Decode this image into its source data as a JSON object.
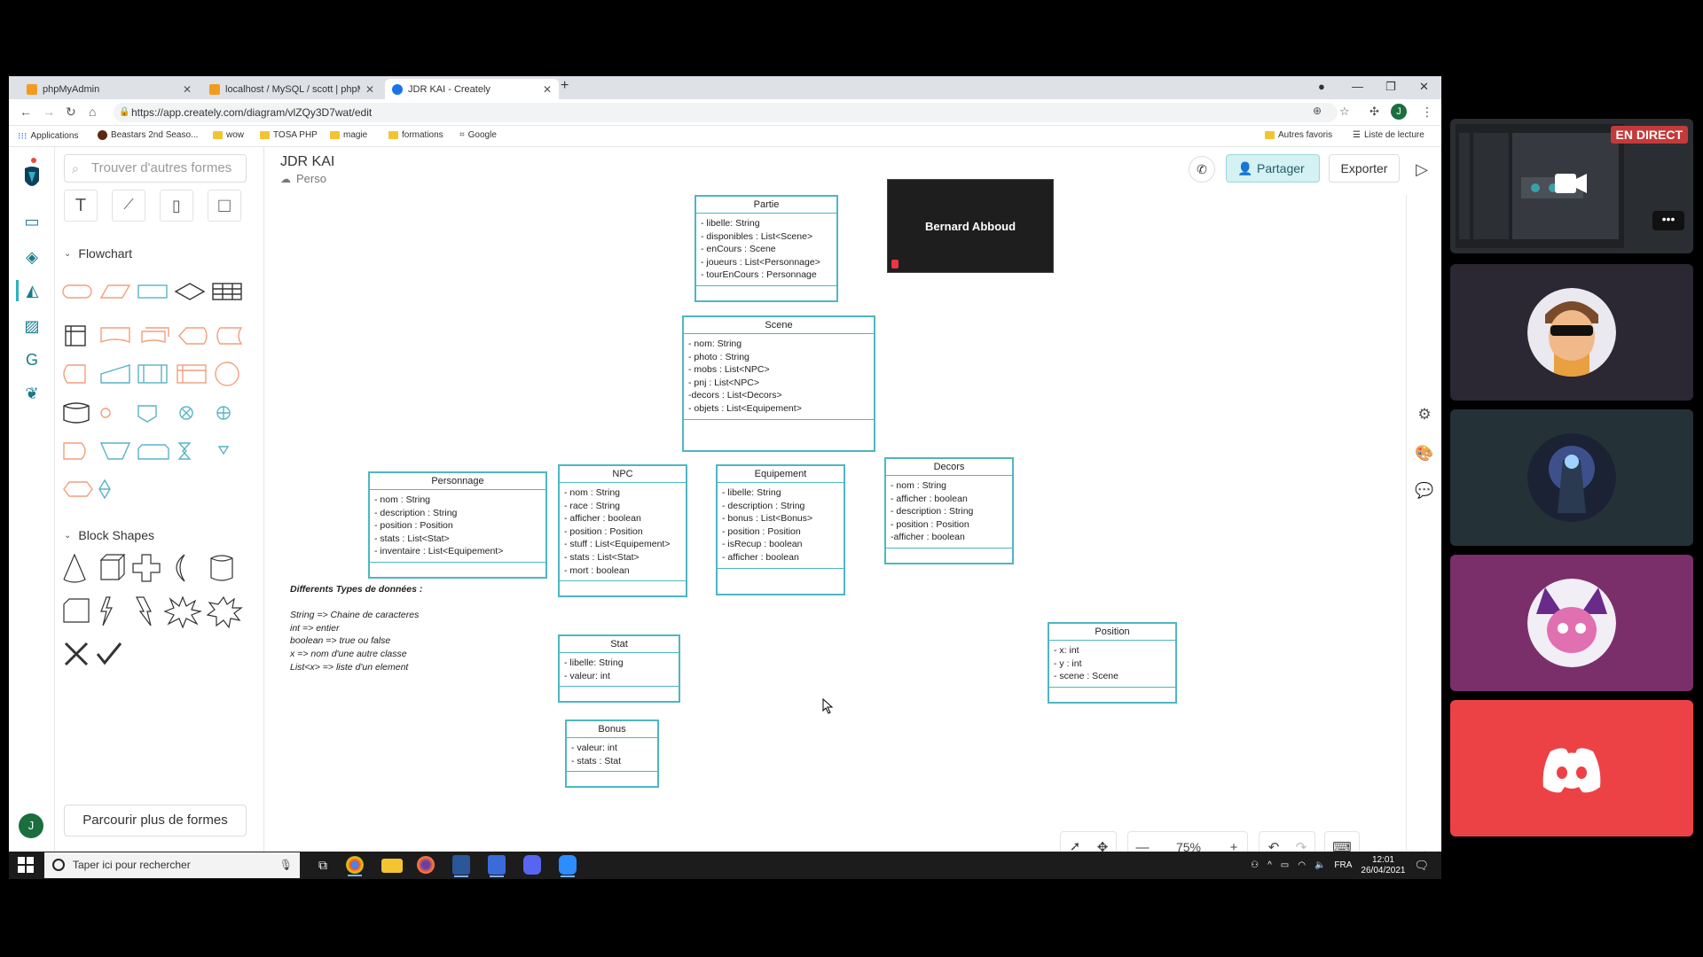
{
  "browser": {
    "tabs": [
      {
        "title": "phpMyAdmin"
      },
      {
        "title": "localhost / MySQL / scott | phpM"
      },
      {
        "title": "JDR KAI - Creately"
      }
    ],
    "url": "https://app.creately.com/diagram/vlZQy3D7wat/edit",
    "bookmarks": [
      "Applications",
      "Beastars 2nd Seaso...",
      "wow",
      "TOSA PHP",
      "magie",
      "formations",
      "Google"
    ],
    "bookmarks_right": [
      "Autres favoris",
      "Liste de lecture"
    ],
    "profile_initial": "J"
  },
  "app": {
    "search_placeholder": "Trouver d'autres formes",
    "flowchart_label": "Flowchart",
    "block_shapes_label": "Block Shapes",
    "browse_more_label": "Parcourir plus de formes",
    "user_initial": "J",
    "doc_title": "JDR KAI",
    "doc_folder": "Perso",
    "share_label": "Partager",
    "export_label": "Exporter",
    "zoom_level": "75%",
    "accent_color": "#4fb6c2"
  },
  "video": {
    "participant": "Bernard Abboud"
  },
  "classes": {
    "partie": {
      "name": "Partie",
      "attrs": [
        "-  libelle: String",
        "- disponibles : List<Scene>",
        "- enCours : Scene",
        "- joueurs : List<Personnage>",
        "- tourEnCours : Personnage"
      ]
    },
    "scene": {
      "name": "Scene",
      "attrs": [
        "-  nom: String",
        "- photo : String",
        "- mobs : List<NPC>",
        "- pnj : List<NPC>",
        "-decors : List<Decors>",
        "- objets : List<Equipement>"
      ]
    },
    "personnage": {
      "name": "Personnage",
      "attrs": [
        "-  nom : String",
        "- description : String",
        "- position : Position",
        "- stats : List<Stat>",
        "- inventaire : List<Equipement>"
      ]
    },
    "npc": {
      "name": "NPC",
      "attrs": [
        "-  nom : String",
        "- race : String",
        "- afficher : boolean",
        "- position : Position",
        "- stuff : List<Equipement>",
        "- stats : List<Stat>",
        "- mort : boolean"
      ]
    },
    "equipement": {
      "name": "Equipement",
      "attrs": [
        "-  libelle: String",
        "- description : String",
        "- bonus : List<Bonus>",
        "- position : Position",
        "- isRecup : boolean",
        "- afficher : boolean"
      ]
    },
    "decors": {
      "name": "Decors",
      "attrs": [
        "-  nom : String",
        "- afficher : boolean",
        "- description : String",
        "- position : Position",
        "-afficher : boolean"
      ]
    },
    "position": {
      "name": "Position",
      "attrs": [
        "-  x: int",
        "- y : int",
        "- scene : Scene"
      ]
    },
    "stat": {
      "name": "Stat",
      "attrs": [
        "-  libelle: String",
        "- valeur: int"
      ]
    },
    "bonus": {
      "name": "Bonus",
      "attrs": [
        "-  valeur: int",
        "- stats : Stat"
      ]
    }
  },
  "legend": {
    "title": "Differents Types de données :",
    "lines": [
      "String => Chaine de caracteres",
      "int => entier",
      "boolean => true ou false",
      "x => nom d'une autre classe",
      "List<x> => liste d'un element"
    ]
  },
  "taskbar": {
    "search_placeholder": "Taper ici pour rechercher",
    "lang": "FRA",
    "time": "12:01",
    "date": "26/04/2021"
  },
  "discord": {
    "live_label": "EN DIRECT"
  }
}
